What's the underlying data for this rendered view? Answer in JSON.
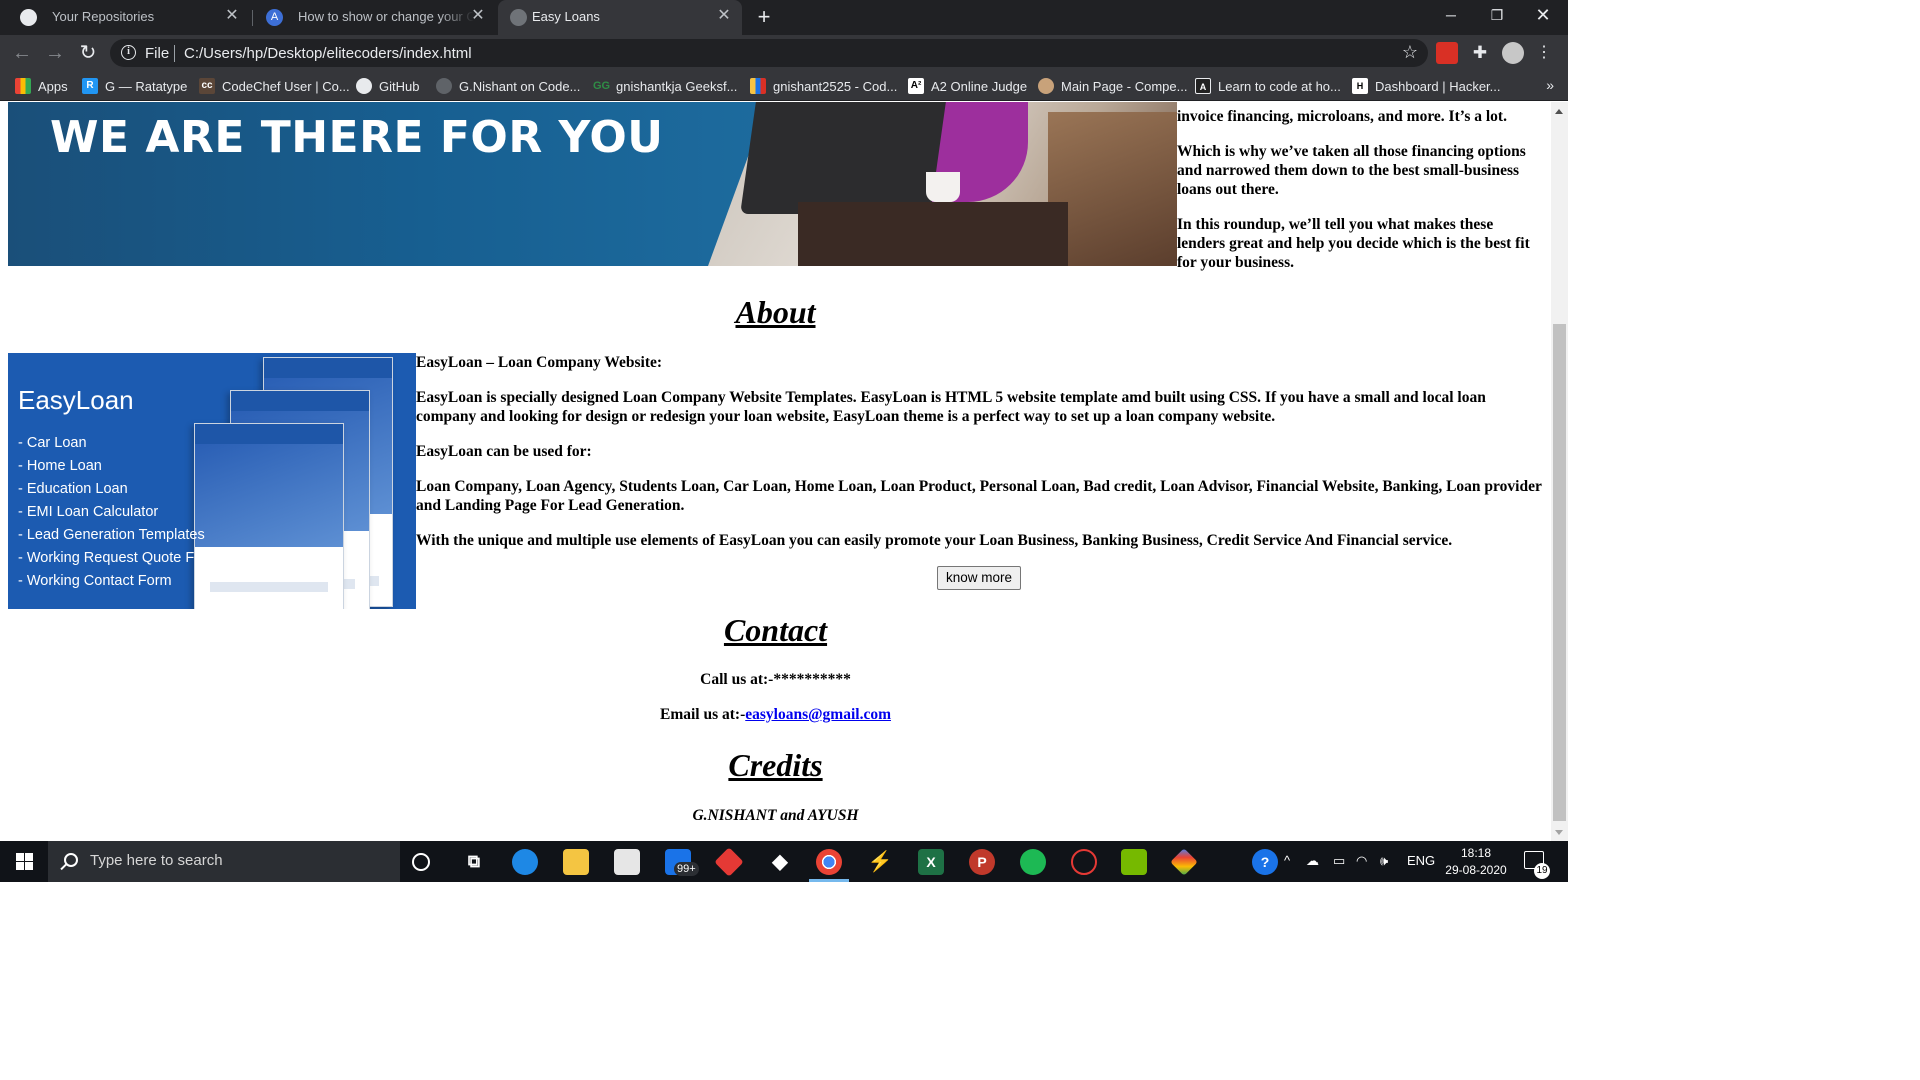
{
  "browser": {
    "tabs": [
      {
        "title": "Your Repositories",
        "icon": "github-icon",
        "active": false
      },
      {
        "title": "How to show or change your Git",
        "icon": "a-logo-icon",
        "active": false
      },
      {
        "title": "Easy Loans",
        "icon": "globe-icon",
        "active": true
      }
    ],
    "address": {
      "scheme": "File",
      "url": "C:/Users/hp/Desktop/elitecoders/index.html"
    },
    "bookmarks": [
      {
        "label": "Apps",
        "icon": "apps-grid-icon"
      },
      {
        "label": "G — Ratatype",
        "icon": "ratatype-icon"
      },
      {
        "label": "CodeChef User | Co...",
        "icon": "codechef-icon"
      },
      {
        "label": "GitHub",
        "icon": "github-icon"
      },
      {
        "label": "G.Nishant on Code...",
        "icon": "codeforces-icon"
      },
      {
        "label": "gnishantkja Geeksf...",
        "icon": "geeksforgeeks-icon"
      },
      {
        "label": "gnishant2525 - Cod...",
        "icon": "codeforces-bars-icon"
      },
      {
        "label": "A2 Online Judge",
        "icon": "a2-icon"
      },
      {
        "label": "Main Page - Compe...",
        "icon": "wiki-icon"
      },
      {
        "label": "Learn to code at ho...",
        "icon": "atcoder-icon"
      },
      {
        "label": "Dashboard | Hacker...",
        "icon": "hackerrank-icon"
      }
    ],
    "bookmarks_more": "»"
  },
  "page": {
    "hero_text": "WE ARE THERE FOR YOU",
    "side_paragraphs": [
      "invoice financing, microloans, and more. It’s a lot.",
      "Which is why we’ve taken all those financing options and narrowed them down to the best small-business loans out there.",
      "In this roundup, we’ll tell you what makes these lenders great and help you decide which is the best fit for your business."
    ],
    "about": {
      "heading": "About",
      "image_title": "EasyLoan",
      "image_list": [
        "- Car Loan",
        "- Home Loan",
        "- Education Loan",
        "- EMI Loan Calculator",
        "- Lead Generation Templates",
        "- Working Request Quote Form",
        "- Working Contact Form"
      ],
      "paragraphs": [
        "EasyLoan – Loan Company Website:",
        "EasyLoan is specially designed Loan Company Website Templates. EasyLoan is HTML 5 website template amd built using CSS. If you have a small and local loan company and looking for design or redesign your loan website, EasyLoan theme is a perfect way to set up a loan company website.",
        "EasyLoan can be used for:",
        "Loan Company, Loan Agency, Students Loan, Car Loan, Home Loan, Loan Product, Personal Loan, Bad credit, Loan Advisor, Financial Website, Banking, Loan provider and Landing Page For Lead Generation.",
        "With the unique and multiple use elements of EasyLoan you can easily promote your Loan Business, Banking Business, Credit Service And Financial service."
      ],
      "button": "know more"
    },
    "contact": {
      "heading": "Contact",
      "call_label": "Call us at:-",
      "call_value": "**********",
      "email_label": "Email us at:-",
      "email_value": "easyloans@gmail.com"
    },
    "credits": {
      "heading": "Credits",
      "names": "G.NISHANT and AYUSH"
    }
  },
  "taskbar": {
    "search_placeholder": "Type here to search",
    "mail_badge": "99+",
    "language": "ENG",
    "time": "18:18",
    "date": "29-08-2020",
    "notification_count": "19"
  },
  "colors": {
    "browser_dark": "#202124",
    "toolbar": "#35363a",
    "hero_blue": "#175f91",
    "about_image_blue": "#1c5bb1",
    "link": "#0000ee",
    "taskbar": "#101318"
  }
}
